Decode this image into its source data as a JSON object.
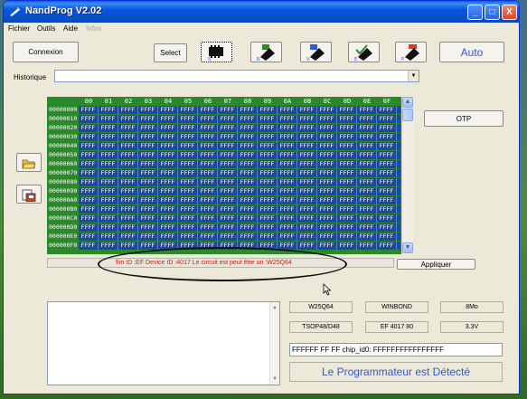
{
  "window": {
    "title": "NandProg V2.02",
    "controls": [
      "_",
      "□",
      "X"
    ]
  },
  "menu": [
    "Fichier",
    "Outils",
    "Aide",
    "Infos"
  ],
  "toolbar": {
    "connexion_label": "Connexion",
    "select_label": "Select",
    "auto_label": "Auto",
    "icon_buttons": [
      {
        "letter": "S",
        "name": "select-chip"
      },
      {
        "letter": "R",
        "name": "read"
      },
      {
        "letter": "V",
        "name": "verify"
      },
      {
        "letter": "E",
        "name": "erase"
      },
      {
        "letter": "P",
        "name": "program"
      }
    ]
  },
  "historique": {
    "label": "Historique",
    "value": ""
  },
  "hex_grid": {
    "columns": [
      "00",
      "01",
      "02",
      "03",
      "04",
      "05",
      "06",
      "07",
      "08",
      "09",
      "0A",
      "0B",
      "0C",
      "0D",
      "0E",
      "0F"
    ],
    "addresses": [
      "00000000",
      "00000010",
      "00000020",
      "00000030",
      "00000040",
      "00000050",
      "00000060",
      "00000070",
      "00000080",
      "00000090",
      "000000A0",
      "000000B0",
      "000000C0",
      "000000D0",
      "000000E0",
      "000000F0"
    ],
    "cell_value": "FFFF"
  },
  "side_buttons": [
    "open-folder",
    "save-file"
  ],
  "otp_label": "OTP",
  "status": {
    "text": "fim ID :EF    Device ID :4017  Le circuit est peut être un :W25Q64",
    "apply_label": "Appliquer"
  },
  "chip_info": {
    "row1": [
      "W25Q64",
      "WINBOND",
      "8Mo"
    ],
    "row2": [
      "TSOP48/D48",
      "EF 4017  80",
      "3.3V"
    ]
  },
  "chip_id_line": "FFFFFF FF FF    chip_id0: FFFFFFFFFFFFFFFF",
  "detect_message": "Le Programmateur est Détecté",
  "colors": {
    "title_bar": "#0a4fc8",
    "grid_header": "#2a8a2a",
    "grid_cells": "#1a4aa8",
    "status_text": "#d02010",
    "accent": "#2f5bd6"
  }
}
